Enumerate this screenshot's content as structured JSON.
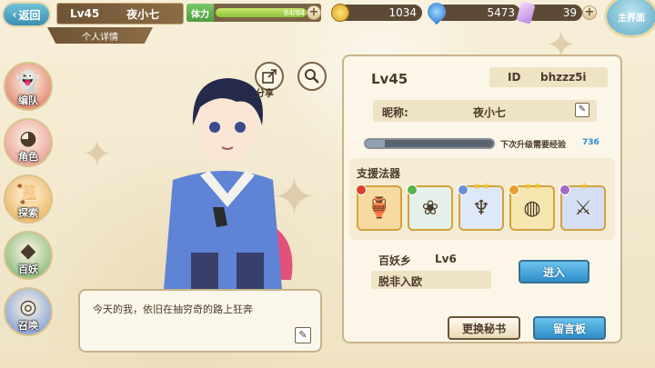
{
  "topbar": {
    "back_label": "返回",
    "level": "Lv45",
    "player_name": "夜小七",
    "detail_tab": "个人详情",
    "stamina_label": "体力",
    "stamina_text": "84/84",
    "stamina_fraction": 1.0,
    "gold": "1034",
    "crystal": "5473",
    "ticket": "39",
    "home_label": "主界面"
  },
  "leftnav": [
    {
      "label": "编队",
      "icon": "ghost-team-icon",
      "color": "#d86a58"
    },
    {
      "label": "角色",
      "icon": "character-icon",
      "color": "#e38a8a"
    },
    {
      "label": "探索",
      "icon": "scroll-icon",
      "color": "#e8a84a"
    },
    {
      "label": "百妖",
      "icon": "yokai-icon",
      "color": "#6fae6a"
    },
    {
      "label": "召唤",
      "icon": "summon-icon",
      "color": "#6a8fd8"
    }
  ],
  "character": {
    "share_label": "分享",
    "quote": "今天的我，依旧在抽穷奇的路上狂奔"
  },
  "profile": {
    "level": "Lv45",
    "id_label": "ID",
    "id_value": "bhzzz5i",
    "nick_label": "昵称:",
    "nick_value": "夜小七",
    "exp_text": "下次升级需要经验",
    "exp_value": "736",
    "exp_fraction": 0.15,
    "support_title": "支援法器",
    "artifacts": [
      {
        "icon": "red-vase-icon",
        "color": "#f6dba0",
        "gem": "#d8402e"
      },
      {
        "icon": "green-charm-icon",
        "color": "#e6f0ea",
        "gem": "#5bb54a"
      },
      {
        "icon": "angel-icon",
        "color": "#dfe8f8",
        "gem": "#6a8fd8"
      },
      {
        "icon": "crystal-ball-icon",
        "color": "#f6e6b0",
        "gem": "#e8a02e"
      },
      {
        "icon": "blue-sword-icon",
        "color": "#d6def6",
        "gem": "#a068c8"
      }
    ],
    "guild_name": "百妖乡",
    "guild_level": "Lv6",
    "motto": "脱非入欧",
    "enter_label": "进入",
    "change_secretary_label": "更换秘书",
    "message_board_label": "留言板"
  }
}
